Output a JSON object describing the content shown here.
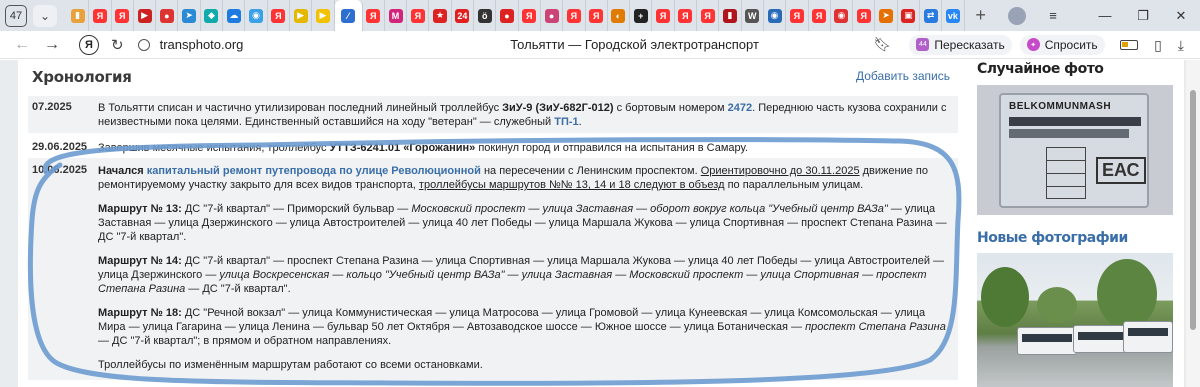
{
  "browser": {
    "tab_count": "47",
    "tab_favicons": [
      {
        "icon": "bookmark-icon",
        "color": "#e9a23b",
        "glyph": "▮"
      },
      {
        "icon": "yandex-icon",
        "color": "#f33",
        "glyph": "Я"
      },
      {
        "icon": "yandex-icon",
        "color": "#f33",
        "glyph": "Я"
      },
      {
        "icon": "video-icon",
        "color": "#c22",
        "glyph": "▶"
      },
      {
        "icon": "circle-icon",
        "color": "#d33",
        "glyph": "●"
      },
      {
        "icon": "arrow-icon",
        "color": "#2a8ad6",
        "glyph": "➤"
      },
      {
        "icon": "drop-icon",
        "color": "#1aa",
        "glyph": "◆"
      },
      {
        "icon": "cloud-icon",
        "color": "#1e7be0",
        "glyph": "☁"
      },
      {
        "icon": "globe-icon",
        "color": "#3aa0e8",
        "glyph": "◉"
      },
      {
        "icon": "yandex-icon",
        "color": "#f33",
        "glyph": "Я"
      },
      {
        "icon": "play-icon",
        "color": "#e5b800",
        "glyph": "▶"
      },
      {
        "icon": "play-icon",
        "color": "#f2c200",
        "glyph": "▶"
      },
      {
        "icon": "transphoto-icon",
        "color": "#2c6fd0",
        "glyph": "⁄"
      },
      {
        "icon": "yandex-icon",
        "color": "#f33",
        "glyph": "Я"
      },
      {
        "icon": "mail-icon",
        "color": "#d2247a",
        "glyph": "M"
      },
      {
        "icon": "yandex-icon",
        "color": "#f33",
        "glyph": "Я"
      },
      {
        "icon": "star-icon",
        "color": "#d22",
        "glyph": "★"
      },
      {
        "icon": "news-icon",
        "color": "#e02020",
        "glyph": "24"
      },
      {
        "icon": "settings-icon",
        "color": "#333",
        "glyph": "ö"
      },
      {
        "icon": "mushroom-icon",
        "color": "#d22",
        "glyph": "●"
      },
      {
        "icon": "yandex-icon",
        "color": "#f33",
        "glyph": "Я"
      },
      {
        "icon": "person-icon",
        "color": "#c47",
        "glyph": "●"
      },
      {
        "icon": "yandex-icon",
        "color": "#f33",
        "glyph": "Я"
      },
      {
        "icon": "yandex-icon",
        "color": "#f33",
        "glyph": "Я"
      },
      {
        "icon": "media-icon",
        "color": "#e07a00",
        "glyph": "◐"
      },
      {
        "icon": "plus-icon",
        "color": "#222",
        "glyph": "+"
      },
      {
        "icon": "yandex-icon",
        "color": "#f33",
        "glyph": "Я"
      },
      {
        "icon": "yandex-icon",
        "color": "#f33",
        "glyph": "Я"
      },
      {
        "icon": "yandex-icon",
        "color": "#f33",
        "glyph": "Я"
      },
      {
        "icon": "book-icon",
        "color": "#b0151d",
        "glyph": "▮"
      },
      {
        "icon": "wikipedia-icon",
        "color": "#555",
        "glyph": "W"
      },
      {
        "icon": "globe-icon",
        "color": "#2a6bb8",
        "glyph": "◉"
      },
      {
        "icon": "yandex-icon",
        "color": "#f33",
        "glyph": "Я"
      },
      {
        "icon": "yandex-icon",
        "color": "#f33",
        "glyph": "Я"
      },
      {
        "icon": "eye-icon",
        "color": "#d33",
        "glyph": "◉"
      },
      {
        "icon": "yandex-icon",
        "color": "#f33",
        "glyph": "Я"
      },
      {
        "icon": "car-icon",
        "color": "#e57000",
        "glyph": "➤"
      },
      {
        "icon": "train-icon",
        "color": "#d22",
        "glyph": "▣"
      },
      {
        "icon": "arrows-icon",
        "color": "#2a7be0",
        "glyph": "⇄"
      },
      {
        "icon": "vk-icon",
        "color": "#2787f5",
        "glyph": "vk"
      }
    ],
    "url": "transphoto.org",
    "page_title": "Тольятти — Городской электротранспорт",
    "summarize_label": "Пересказать",
    "ask_label": "Спросить"
  },
  "main": {
    "section_title": "Хронология",
    "add_entry_label": "Добавить запись",
    "entries": [
      {
        "date": "07.2025",
        "t1": "В Тольятти списан и частично утилизирован последний линейный троллейбус ",
        "model": "ЗиУ-9 (ЗиУ-682Г-012)",
        "t2": " с бортовым номером ",
        "number": "2472",
        "t3": ". Переднюю часть кузова сохранили с неизвестными пока целями. Единственный оставшийся на ходу \"ветеран\" — служебный ",
        "service": "ТП-1",
        "t4": "."
      },
      {
        "date": "29.06.2025",
        "t1": "Завершив месячные испытания, троллейбус ",
        "model": "УТТЗ-6241.01 «Горожанин»",
        "t2": " покинул город и отправился на испытания в Самару."
      },
      {
        "date": "10.06.2025",
        "t_started": "Начался ",
        "link": "капитальный ремонт путепровода по улице Революционной",
        "t1": " на пересечении с Ленинским проспектом. ",
        "u1": "Ориентировочно до 30.11.2025",
        "t2": " движение по ремонтируемому участку закрыто для всех видов транспорта, ",
        "u2": "троллейбусы маршрутов №№ 13, 14 и 18 следуют в объезд",
        "t3": " по параллельным улицам.",
        "route13_title": "Маршрут № 13:",
        "route13_a": " ДС \"7-й квартал\" — Приморский бульвар — ",
        "route13_i1": "Московский проспект — улица Заставная — оборот вокруг кольца \"Учебный центр ВАЗа\" —",
        "route13_b": " улица Заставная — улица Дзержинского — улица Автостроителей — улица 40 лет Победы — улица Маршала Жукова — улица Спортивная — проспект Степана Разина — ДС \"7-й квартал\".",
        "route14_title": "Маршрут № 14:",
        "route14_a": " ДС \"7-й квартал\" — проспект Степана Разина — улица Спортивная — улица Маршала Жукова — улица 40 лет Победы — улица Автостроителей — улица Дзержинского — ",
        "route14_i1": "улица Воскресенская — кольцо \"Учебный центр ВАЗа\" — улица Заставная — Московский проспект — улица Спортивная — проспект Степана Разина",
        "route14_b": " — ДС \"7-й квартал\".",
        "route18_title": "Маршрут № 18:",
        "route18_a": " ДС \"Речной вокзал\" — улица Коммунистическая — улица Матросова — улица Громовой — улица Кунеевская — улица Комсомольская — улица Мира — улица Гагарина — улица Ленина — бульвар 50 лет Октября — Автозаводское шоссе — Южное шоссе — улица Ботаническая — ",
        "route18_i1": "проспект Степана Разина",
        "route18_b": " — ДС \"7-й квартал\"; в прямом и обратном направлениях.",
        "footer": "Троллейбусы по изменённым маршрутам работают со всеми остановками."
      }
    ]
  },
  "sidebar": {
    "random_title": "Случайное фото",
    "plate_text": "BELKOMMUNMASH",
    "plate_mark": "ЕАС",
    "new_title": "Новые фотографии"
  },
  "colors": {
    "link": "#3a6ea8",
    "highlight": "#6c9bcf"
  }
}
